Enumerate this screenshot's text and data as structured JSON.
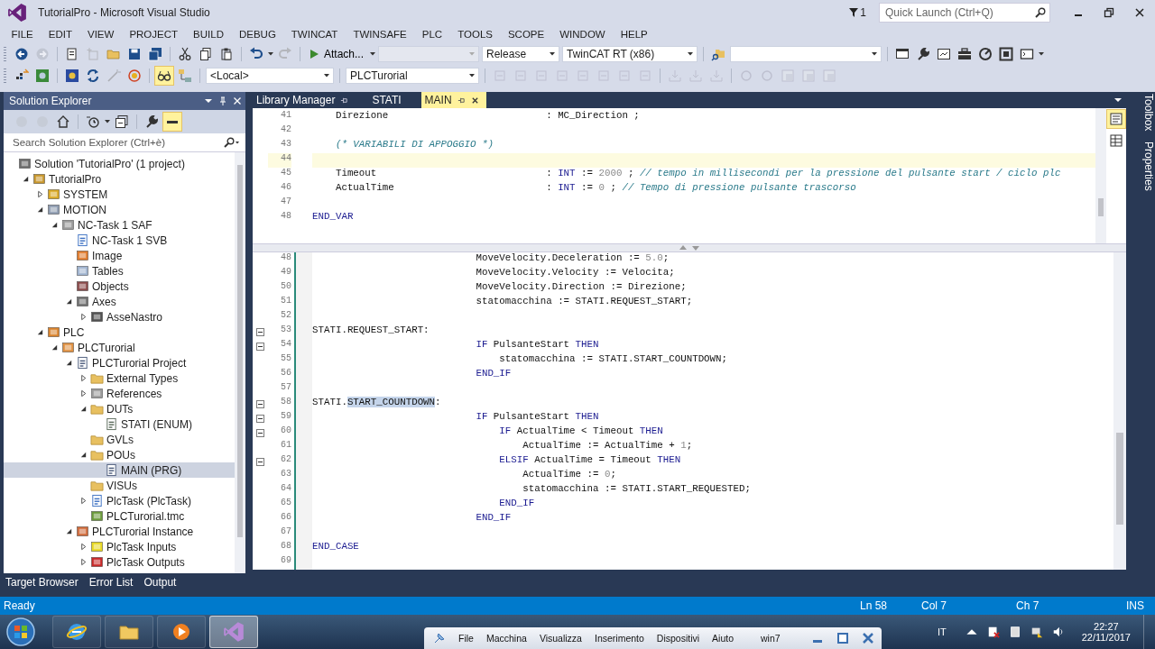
{
  "window": {
    "title": "TutorialPro - Microsoft Visual Studio"
  },
  "notifications": {
    "count": "1"
  },
  "quick_launch": {
    "placeholder": "Quick Launch (Ctrl+Q)"
  },
  "menu": [
    "FILE",
    "EDIT",
    "VIEW",
    "PROJECT",
    "BUILD",
    "DEBUG",
    "TWINCAT",
    "TWINSAFE",
    "PLC",
    "TOOLS",
    "SCOPE",
    "WINDOW",
    "HELP"
  ],
  "toolbar": {
    "attach_button": "Attach...",
    "configuration": "Release",
    "platform": "TwinCAT RT (x86)",
    "target": "<Local>",
    "project": "PLCTurorial"
  },
  "solution_explorer": {
    "title": "Solution Explorer",
    "search": {
      "placeholder": "Search Solution Explorer (Ctrl+è)"
    },
    "tree": [
      {
        "label": "Solution 'TutorialPro' (1 project)",
        "kind": "solution",
        "selected": false,
        "children": [
          {
            "label": "TutorialPro",
            "kind": "project",
            "expanded": true,
            "selected": false,
            "children": [
              {
                "label": "SYSTEM",
                "kind": "system",
                "expanded": false,
                "selected": false
              },
              {
                "label": "MOTION",
                "kind": "motion",
                "expanded": true,
                "selected": false,
                "children": [
                  {
                    "label": "NC-Task 1 SAF",
                    "kind": "task",
                    "expanded": true,
                    "selected": false,
                    "children": [
                      {
                        "label": "NC-Task 1 SVB",
                        "kind": "document",
                        "selected": false
                      },
                      {
                        "label": "Image",
                        "kind": "image",
                        "selected": false
                      },
                      {
                        "label": "Tables",
                        "kind": "table",
                        "selected": false
                      },
                      {
                        "label": "Objects",
                        "kind": "objects",
                        "selected": false
                      },
                      {
                        "label": "Axes",
                        "kind": "axes",
                        "expanded": true,
                        "selected": false,
                        "children": [
                          {
                            "label": "AsseNastro",
                            "kind": "axis",
                            "expanded": false,
                            "selected": false
                          }
                        ]
                      }
                    ]
                  }
                ]
              },
              {
                "label": "PLC",
                "kind": "plc",
                "expanded": true,
                "selected": false,
                "children": [
                  {
                    "label": "PLCTurorial",
                    "kind": "plcproject",
                    "expanded": true,
                    "selected": false,
                    "children": [
                      {
                        "label": "PLCTurorial Project",
                        "kind": "program",
                        "expanded": true,
                        "selected": false,
                        "children": [
                          {
                            "label": "External Types",
                            "kind": "folder",
                            "expanded": false,
                            "selected": false
                          },
                          {
                            "label": "References",
                            "kind": "references",
                            "expanded": false,
                            "selected": false
                          },
                          {
                            "label": "DUTs",
                            "kind": "folder",
                            "expanded": true,
                            "selected": false,
                            "children": [
                              {
                                "label": "STATI (ENUM)",
                                "kind": "enum",
                                "selected": false
                              }
                            ]
                          },
                          {
                            "label": "GVLs",
                            "kind": "folder",
                            "selected": false
                          },
                          {
                            "label": "POUs",
                            "kind": "folder",
                            "expanded": true,
                            "selected": false,
                            "children": [
                              {
                                "label": "MAIN (PRG)",
                                "kind": "program",
                                "selected": true
                              }
                            ]
                          },
                          {
                            "label": "VISUs",
                            "kind": "folder",
                            "selected": false
                          },
                          {
                            "label": "PlcTask (PlcTask)",
                            "kind": "document",
                            "expanded": false,
                            "selected": false
                          },
                          {
                            "label": "PLCTurorial.tmc",
                            "kind": "tmc",
                            "selected": false
                          }
                        ]
                      },
                      {
                        "label": "PLCTurorial Instance",
                        "kind": "instance",
                        "expanded": true,
                        "selected": false,
                        "children": [
                          {
                            "label": "PlcTask Inputs",
                            "kind": "inputs",
                            "expanded": false,
                            "selected": false
                          },
                          {
                            "label": "PlcTask Outputs",
                            "kind": "outputs",
                            "expanded": false,
                            "selected": false
                          }
                        ]
                      }
                    ]
                  }
                ]
              }
            ]
          }
        ]
      }
    ]
  },
  "editor_tabs": [
    {
      "label": "Library Manager",
      "selected": false,
      "pinned": true
    },
    {
      "label": "STATI",
      "selected": false,
      "pinned": false
    },
    {
      "label": "MAIN",
      "selected": true,
      "pinned": true
    }
  ],
  "declaration_pane": {
    "lines": [
      {
        "number": "41",
        "current": false,
        "segments": [
          {
            "kind": "plain",
            "text": "    Direzione                           : MC_Direction ;"
          }
        ]
      },
      {
        "number": "42",
        "current": false
      },
      {
        "number": "43",
        "current": false,
        "segments": [
          {
            "kind": "comment",
            "text": "    (* VARIABILI DI APPOGGIO *)"
          }
        ]
      },
      {
        "number": "44",
        "current": true
      },
      {
        "number": "45",
        "current": false,
        "segments": [
          {
            "kind": "plain",
            "text": "    Timeout                             : "
          },
          {
            "kind": "keyword",
            "text": "INT"
          },
          {
            "kind": "plain",
            "text": " := "
          },
          {
            "kind": "number",
            "text": "2000"
          },
          {
            "kind": "plain",
            "text": " ; "
          },
          {
            "kind": "comment",
            "text": "// tempo in millisecondi per la pressione del pulsante start / ciclo plc"
          }
        ]
      },
      {
        "number": "46",
        "current": false,
        "segments": [
          {
            "kind": "plain",
            "text": "    ActualTime                          : "
          },
          {
            "kind": "keyword",
            "text": "INT"
          },
          {
            "kind": "plain",
            "text": " := "
          },
          {
            "kind": "number",
            "text": "0"
          },
          {
            "kind": "plain",
            "text": " ; "
          },
          {
            "kind": "comment",
            "text": "// Tempo di pressione pulsante trascorso"
          }
        ]
      },
      {
        "number": "47",
        "current": false
      },
      {
        "number": "48",
        "current": false,
        "segments": [
          {
            "kind": "keyword",
            "text": "END_VAR"
          }
        ]
      }
    ]
  },
  "implementation_pane": {
    "lines": [
      {
        "number": "48",
        "fold": false,
        "segments": [
          {
            "kind": "plain",
            "text": "                            MoveVelocity.Deceleration := "
          },
          {
            "kind": "number",
            "text": "5.0"
          },
          {
            "kind": "plain",
            "text": ";"
          }
        ]
      },
      {
        "number": "49",
        "fold": false,
        "segments": [
          {
            "kind": "plain",
            "text": "                            MoveVelocity.Velocity := Velocita;"
          }
        ]
      },
      {
        "number": "50",
        "fold": false,
        "segments": [
          {
            "kind": "plain",
            "text": "                            MoveVelocity.Direction := Direzione;"
          }
        ]
      },
      {
        "number": "51",
        "fold": false,
        "segments": [
          {
            "kind": "plain",
            "text": "                            statomacchina := STATI.REQUEST_START;"
          }
        ]
      },
      {
        "number": "52",
        "fold": false
      },
      {
        "number": "53",
        "fold": true,
        "segments": [
          {
            "kind": "plain",
            "text": "STATI.REQUEST_START:"
          }
        ]
      },
      {
        "number": "54",
        "fold": true,
        "segments": [
          {
            "kind": "keyword",
            "text": "                            IF"
          },
          {
            "kind": "plain",
            "text": " PulsanteStart "
          },
          {
            "kind": "keyword",
            "text": "THEN"
          }
        ]
      },
      {
        "number": "55",
        "fold": false,
        "segments": [
          {
            "kind": "plain",
            "text": "                                statomacchina := STATI.START_COUNTDOWN;"
          }
        ]
      },
      {
        "number": "56",
        "fold": false,
        "segments": [
          {
            "kind": "keyword",
            "text": "                            END_IF"
          }
        ]
      },
      {
        "number": "57",
        "fold": false
      },
      {
        "number": "58",
        "fold": true,
        "segments": [
          {
            "kind": "plain",
            "text": "STATI."
          },
          {
            "kind": "selection",
            "text": "START_COUNTDOWN"
          },
          {
            "kind": "plain",
            "text": ":"
          }
        ]
      },
      {
        "number": "59",
        "fold": true,
        "segments": [
          {
            "kind": "keyword",
            "text": "                            IF"
          },
          {
            "kind": "plain",
            "text": " PulsanteStart "
          },
          {
            "kind": "keyword",
            "text": "THEN"
          }
        ]
      },
      {
        "number": "60",
        "fold": true,
        "segments": [
          {
            "kind": "keyword",
            "text": "                                IF"
          },
          {
            "kind": "plain",
            "text": " ActualTime < Timeout "
          },
          {
            "kind": "keyword",
            "text": "THEN"
          }
        ]
      },
      {
        "number": "61",
        "fold": false,
        "segments": [
          {
            "kind": "plain",
            "text": "                                    ActualTime := ActualTime + "
          },
          {
            "kind": "number",
            "text": "1"
          },
          {
            "kind": "plain",
            "text": ";"
          }
        ]
      },
      {
        "number": "62",
        "fold": true,
        "segments": [
          {
            "kind": "keyword",
            "text": "                                ELSIF"
          },
          {
            "kind": "plain",
            "text": " ActualTime = Timeout "
          },
          {
            "kind": "keyword",
            "text": "THEN"
          }
        ]
      },
      {
        "number": "63",
        "fold": false,
        "segments": [
          {
            "kind": "plain",
            "text": "                                    ActualTime := "
          },
          {
            "kind": "number",
            "text": "0"
          },
          {
            "kind": "plain",
            "text": ";"
          }
        ]
      },
      {
        "number": "64",
        "fold": false,
        "segments": [
          {
            "kind": "plain",
            "text": "                                    statomacchina := STATI.START_REQUESTED;"
          }
        ]
      },
      {
        "number": "65",
        "fold": false,
        "segments": [
          {
            "kind": "keyword",
            "text": "                                END_IF"
          }
        ]
      },
      {
        "number": "66",
        "fold": false,
        "segments": [
          {
            "kind": "keyword",
            "text": "                            END_IF"
          }
        ]
      },
      {
        "number": "67",
        "fold": false
      },
      {
        "number": "68",
        "fold": false,
        "segments": [
          {
            "kind": "keyword",
            "text": "END_CASE"
          }
        ]
      },
      {
        "number": "69",
        "fold": false
      }
    ]
  },
  "side_tabs": [
    "Toolbox",
    "Properties"
  ],
  "bottom_tabs": [
    "Target Browser",
    "Error List",
    "Output"
  ],
  "status_bar": {
    "message": "Ready",
    "line": "Ln 58",
    "column": "Col 7",
    "char": "Ch 7",
    "mode": "INS"
  },
  "taskbar": {
    "apps": [
      {
        "kind": "browser",
        "selected": false
      },
      {
        "kind": "folder",
        "selected": false
      },
      {
        "kind": "media",
        "selected": false
      },
      {
        "kind": "studio",
        "selected": true
      }
    ],
    "vm_menu": [
      "File",
      "Macchina",
      "Visualizza",
      "Inserimento",
      "Dispositivi",
      "Aiuto"
    ],
    "vm_title": "win7",
    "language": "IT",
    "time": "22:27",
    "date": "22/11/2017"
  }
}
